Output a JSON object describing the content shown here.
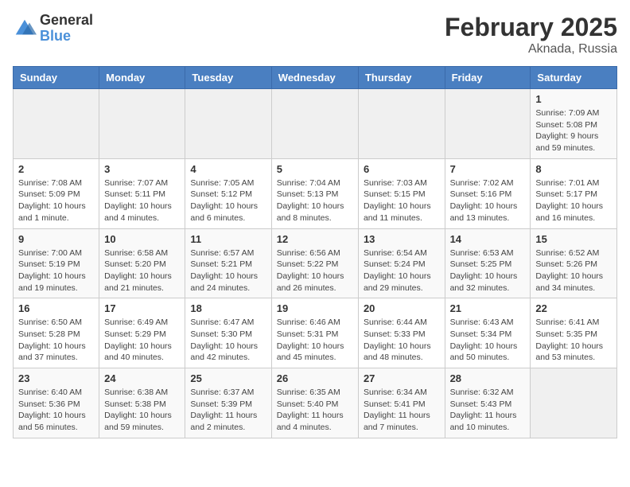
{
  "header": {
    "logo_general": "General",
    "logo_blue": "Blue",
    "month_title": "February 2025",
    "location": "Aknada, Russia"
  },
  "weekdays": [
    "Sunday",
    "Monday",
    "Tuesday",
    "Wednesday",
    "Thursday",
    "Friday",
    "Saturday"
  ],
  "weeks": [
    [
      {
        "day": "",
        "info": ""
      },
      {
        "day": "",
        "info": ""
      },
      {
        "day": "",
        "info": ""
      },
      {
        "day": "",
        "info": ""
      },
      {
        "day": "",
        "info": ""
      },
      {
        "day": "",
        "info": ""
      },
      {
        "day": "1",
        "info": "Sunrise: 7:09 AM\nSunset: 5:08 PM\nDaylight: 9 hours\nand 59 minutes."
      }
    ],
    [
      {
        "day": "2",
        "info": "Sunrise: 7:08 AM\nSunset: 5:09 PM\nDaylight: 10 hours\nand 1 minute."
      },
      {
        "day": "3",
        "info": "Sunrise: 7:07 AM\nSunset: 5:11 PM\nDaylight: 10 hours\nand 4 minutes."
      },
      {
        "day": "4",
        "info": "Sunrise: 7:05 AM\nSunset: 5:12 PM\nDaylight: 10 hours\nand 6 minutes."
      },
      {
        "day": "5",
        "info": "Sunrise: 7:04 AM\nSunset: 5:13 PM\nDaylight: 10 hours\nand 8 minutes."
      },
      {
        "day": "6",
        "info": "Sunrise: 7:03 AM\nSunset: 5:15 PM\nDaylight: 10 hours\nand 11 minutes."
      },
      {
        "day": "7",
        "info": "Sunrise: 7:02 AM\nSunset: 5:16 PM\nDaylight: 10 hours\nand 13 minutes."
      },
      {
        "day": "8",
        "info": "Sunrise: 7:01 AM\nSunset: 5:17 PM\nDaylight: 10 hours\nand 16 minutes."
      }
    ],
    [
      {
        "day": "9",
        "info": "Sunrise: 7:00 AM\nSunset: 5:19 PM\nDaylight: 10 hours\nand 19 minutes."
      },
      {
        "day": "10",
        "info": "Sunrise: 6:58 AM\nSunset: 5:20 PM\nDaylight: 10 hours\nand 21 minutes."
      },
      {
        "day": "11",
        "info": "Sunrise: 6:57 AM\nSunset: 5:21 PM\nDaylight: 10 hours\nand 24 minutes."
      },
      {
        "day": "12",
        "info": "Sunrise: 6:56 AM\nSunset: 5:22 PM\nDaylight: 10 hours\nand 26 minutes."
      },
      {
        "day": "13",
        "info": "Sunrise: 6:54 AM\nSunset: 5:24 PM\nDaylight: 10 hours\nand 29 minutes."
      },
      {
        "day": "14",
        "info": "Sunrise: 6:53 AM\nSunset: 5:25 PM\nDaylight: 10 hours\nand 32 minutes."
      },
      {
        "day": "15",
        "info": "Sunrise: 6:52 AM\nSunset: 5:26 PM\nDaylight: 10 hours\nand 34 minutes."
      }
    ],
    [
      {
        "day": "16",
        "info": "Sunrise: 6:50 AM\nSunset: 5:28 PM\nDaylight: 10 hours\nand 37 minutes."
      },
      {
        "day": "17",
        "info": "Sunrise: 6:49 AM\nSunset: 5:29 PM\nDaylight: 10 hours\nand 40 minutes."
      },
      {
        "day": "18",
        "info": "Sunrise: 6:47 AM\nSunset: 5:30 PM\nDaylight: 10 hours\nand 42 minutes."
      },
      {
        "day": "19",
        "info": "Sunrise: 6:46 AM\nSunset: 5:31 PM\nDaylight: 10 hours\nand 45 minutes."
      },
      {
        "day": "20",
        "info": "Sunrise: 6:44 AM\nSunset: 5:33 PM\nDaylight: 10 hours\nand 48 minutes."
      },
      {
        "day": "21",
        "info": "Sunrise: 6:43 AM\nSunset: 5:34 PM\nDaylight: 10 hours\nand 50 minutes."
      },
      {
        "day": "22",
        "info": "Sunrise: 6:41 AM\nSunset: 5:35 PM\nDaylight: 10 hours\nand 53 minutes."
      }
    ],
    [
      {
        "day": "23",
        "info": "Sunrise: 6:40 AM\nSunset: 5:36 PM\nDaylight: 10 hours\nand 56 minutes."
      },
      {
        "day": "24",
        "info": "Sunrise: 6:38 AM\nSunset: 5:38 PM\nDaylight: 10 hours\nand 59 minutes."
      },
      {
        "day": "25",
        "info": "Sunrise: 6:37 AM\nSunset: 5:39 PM\nDaylight: 11 hours\nand 2 minutes."
      },
      {
        "day": "26",
        "info": "Sunrise: 6:35 AM\nSunset: 5:40 PM\nDaylight: 11 hours\nand 4 minutes."
      },
      {
        "day": "27",
        "info": "Sunrise: 6:34 AM\nSunset: 5:41 PM\nDaylight: 11 hours\nand 7 minutes."
      },
      {
        "day": "28",
        "info": "Sunrise: 6:32 AM\nSunset: 5:43 PM\nDaylight: 11 hours\nand 10 minutes."
      },
      {
        "day": "",
        "info": ""
      }
    ]
  ]
}
